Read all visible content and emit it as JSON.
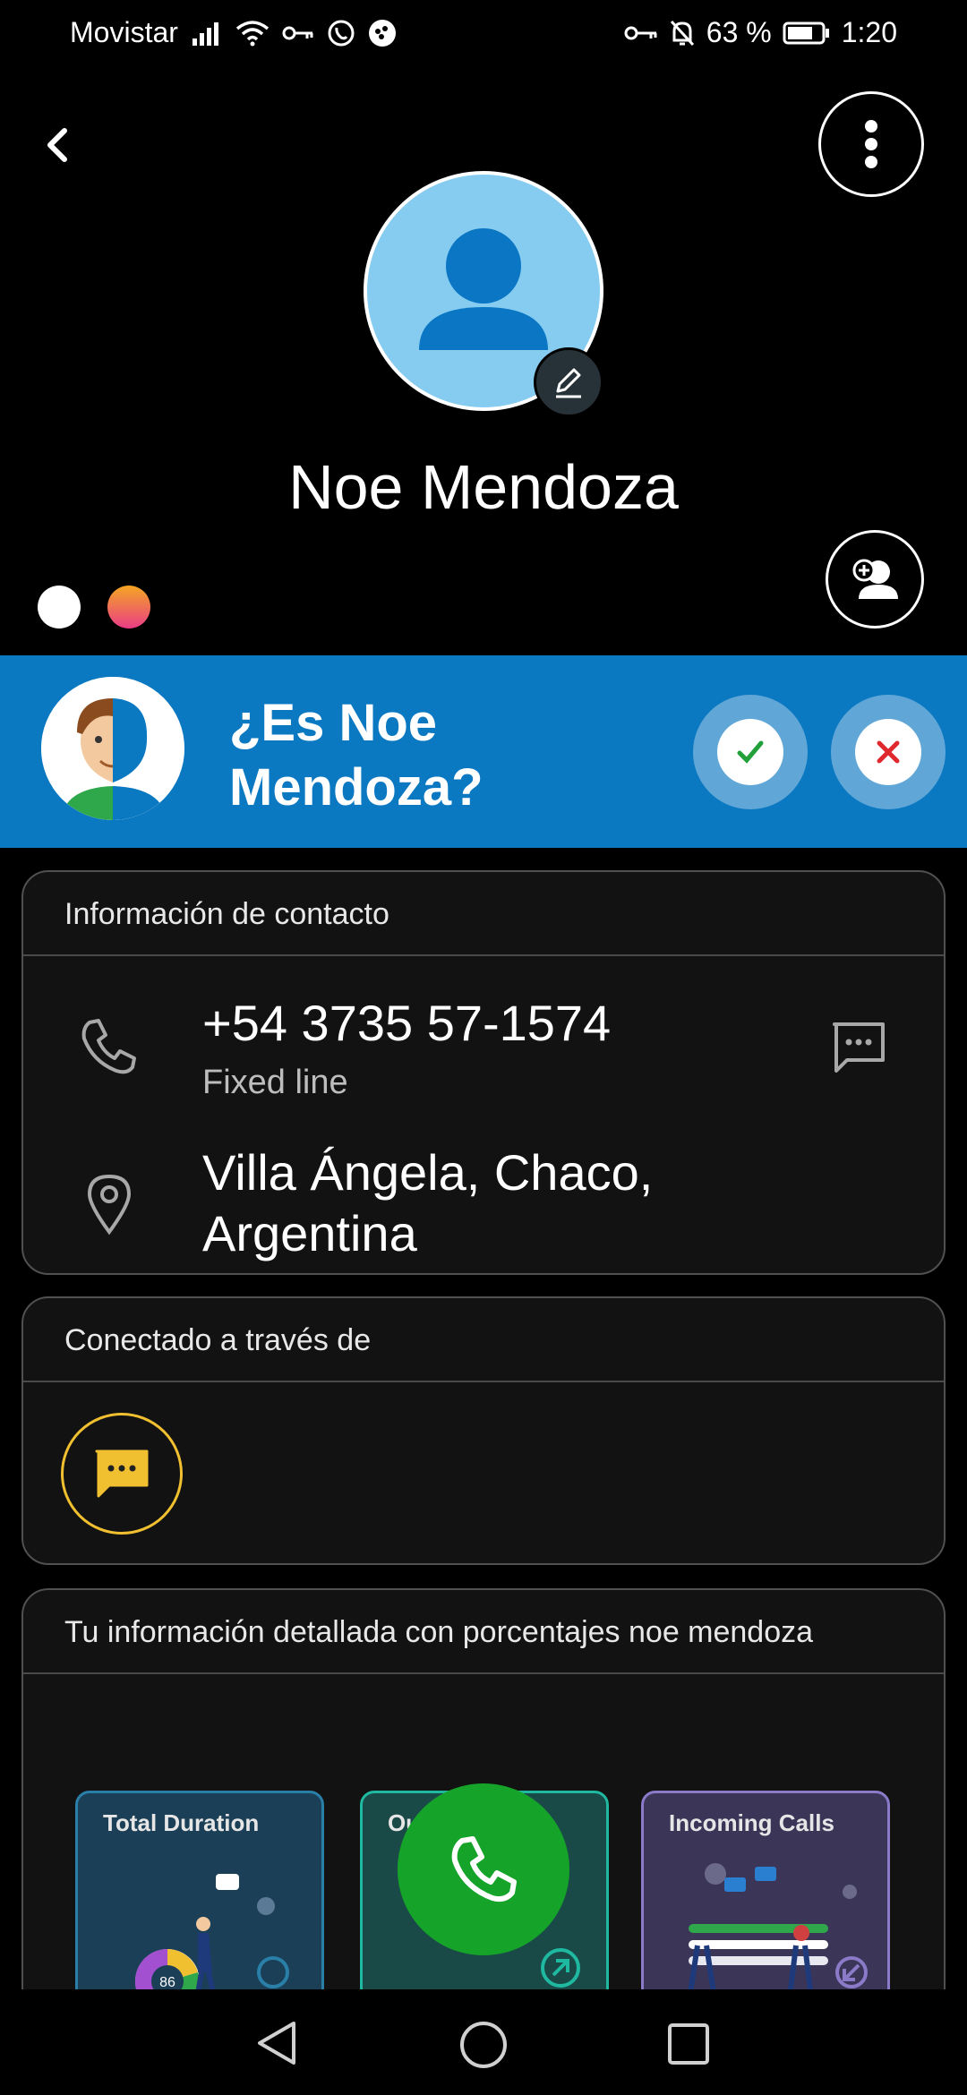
{
  "status_bar": {
    "carrier": "Movistar",
    "battery": "63 %",
    "time": "1:20"
  },
  "contact": {
    "name": "Noe Mendoza"
  },
  "banner": {
    "question": "¿Es Noe Mendoza?"
  },
  "contact_info": {
    "title": "Información de contacto",
    "phone": "+54 3735 57-1574",
    "phone_type": "Fixed line",
    "location": "Villa Ángela, Chaco, Argentina"
  },
  "connected": {
    "title": "Conectado a través de"
  },
  "detailed": {
    "title": "Tu información detallada con porcentajes noe mendoza",
    "tiles": [
      {
        "label": "Total Duration",
        "value": "86"
      },
      {
        "label": "Ou"
      },
      {
        "label": "Incoming Calls"
      }
    ]
  },
  "colors": {
    "banner": "#0b78c2",
    "call_button": "#15a329",
    "avatar_bg": "#85ccf0",
    "connected_ring": "#f0c030"
  }
}
